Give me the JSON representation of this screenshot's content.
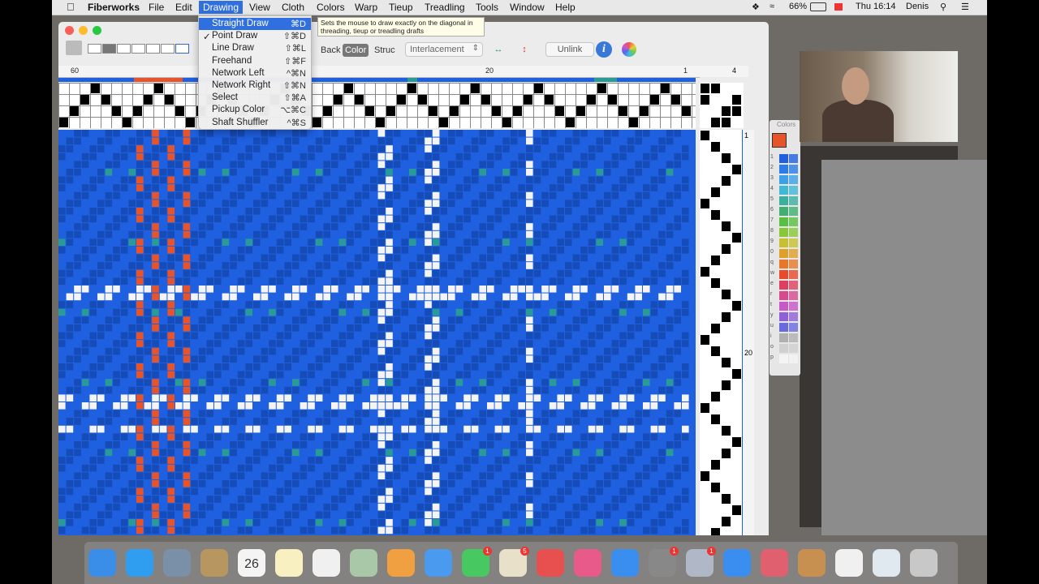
{
  "menubar": {
    "app_name": "Fiberworks",
    "menus": [
      "File",
      "Edit",
      "Drawing",
      "View",
      "Cloth",
      "Colors",
      "Warp",
      "Tieup",
      "Treadling",
      "Tools",
      "Window",
      "Help"
    ],
    "active_menu": "Drawing",
    "battery": "66%",
    "clock": "Thu 16:14",
    "user": "Denis"
  },
  "toolbar": {
    "back_label": "Back",
    "color_label": "Color",
    "struc_label": "Struc",
    "interlacement_value": "Interlacement",
    "unlink_label": "Unlink"
  },
  "ruler": {
    "ticks": [
      "60",
      "20",
      "1"
    ],
    "tieup_tick": "4"
  },
  "side_ruler": {
    "top": "1",
    "mid": "20"
  },
  "drawing_menu": {
    "items": [
      {
        "label": "Straight Draw",
        "shortcut": "⌘D",
        "checked": false,
        "highlighted": true
      },
      {
        "label": "Point Draw",
        "shortcut": "⇧⌘D",
        "checked": true,
        "highlighted": false
      },
      {
        "label": "Line Draw",
        "shortcut": "⇧⌘L",
        "checked": false,
        "highlighted": false
      },
      {
        "label": "Freehand",
        "shortcut": "⇧⌘F",
        "checked": false,
        "highlighted": false
      },
      {
        "label": "Network Left",
        "shortcut": "^⌘N",
        "checked": false,
        "highlighted": false
      },
      {
        "label": "Network Right",
        "shortcut": "⇧⌘N",
        "checked": false,
        "highlighted": false
      },
      {
        "label": "Select",
        "shortcut": "⇧⌘A",
        "checked": false,
        "highlighted": false
      },
      {
        "label": "Pickup Color",
        "shortcut": "⌥⌘C",
        "checked": false,
        "highlighted": false
      },
      {
        "label": "Shaft Shuffler",
        "shortcut": "^⌘S",
        "checked": false,
        "highlighted": false
      }
    ],
    "tooltip": "Sets the mouse to draw exactly on the diagonal in threading, tieup or treadling drafts"
  },
  "palette": {
    "title": "Colors",
    "row_labels": [
      "1",
      "2",
      "3",
      "4",
      "5",
      "6",
      "7",
      "8",
      "9",
      "0",
      "q",
      "w",
      "e",
      "r",
      "t",
      "y",
      "u",
      "i",
      "o",
      "p"
    ],
    "swatches": [
      "#2060e0",
      "#2b7be8",
      "#3aa0e8",
      "#40b8d8",
      "#3ab0a0",
      "#40b070",
      "#58c040",
      "#88c838",
      "#c8c030",
      "#e0a028",
      "#e87828",
      "#e84a2a",
      "#e04060",
      "#d84a90",
      "#c858c8",
      "#9060d8",
      "#6a6ae0",
      "#b0b0b0",
      "#d0d0d0",
      "#f4f4f4"
    ],
    "selected_color": "#e8542a"
  },
  "dock": {
    "calendar_day": "26",
    "badges": [
      "1",
      "5",
      "1",
      "1"
    ]
  },
  "colors": {
    "blue": "#1e60e0",
    "blue_dark": "#164cb8",
    "teal": "#2a9a96",
    "orange": "#e8542a",
    "white": "#f4f4f4"
  }
}
